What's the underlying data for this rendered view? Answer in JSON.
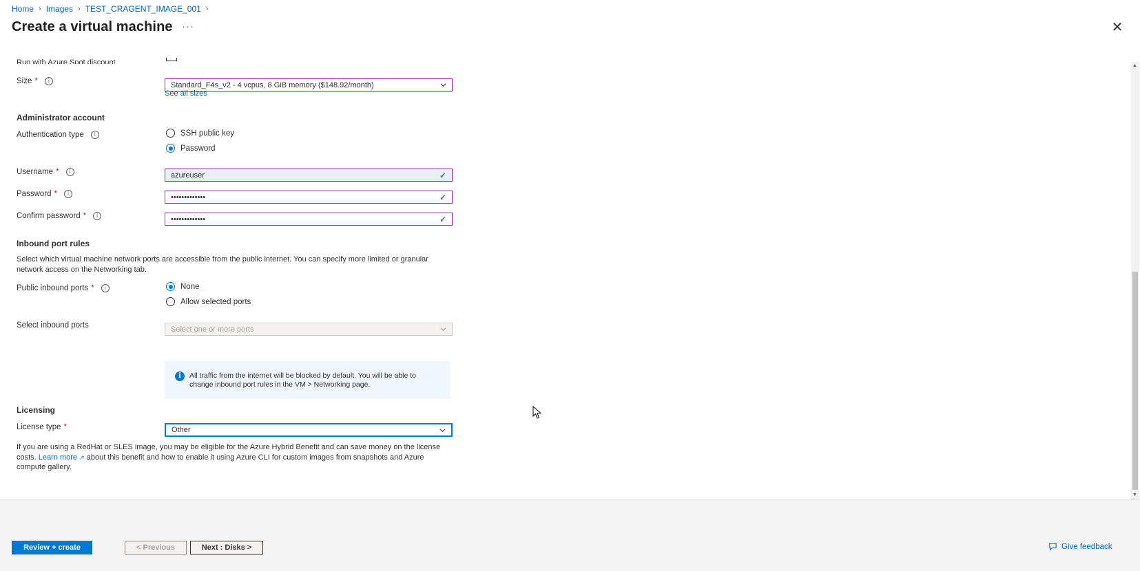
{
  "breadcrumb": {
    "items": [
      "Home",
      "Images",
      "TEST_CRAGENT_IMAGE_001"
    ]
  },
  "page": {
    "title": "Create a virtual machine",
    "more": "···",
    "close": "✕"
  },
  "partial_row": {
    "label": "Run with Azure Spot discount"
  },
  "size": {
    "label": "Size",
    "required": "*",
    "value": "Standard_F4s_v2 - 4 vcpus, 8 GiB memory ($148.92/month)",
    "see_all": "See all sizes"
  },
  "admin": {
    "heading": "Administrator account",
    "auth_label": "Authentication type",
    "auth_options": [
      "SSH public key",
      "Password"
    ],
    "auth_selected": "Password",
    "username_label": "Username",
    "username_value": "azureuser",
    "password_label": "Password",
    "password_value": "•••••••••••••",
    "confirm_label": "Confirm password",
    "confirm_value": "•••••••••••••"
  },
  "inbound": {
    "heading": "Inbound port rules",
    "description": "Select which virtual machine network ports are accessible from the public internet. You can specify more limited or granular network access on the Networking tab.",
    "public_label": "Public inbound ports",
    "public_options": [
      "None",
      "Allow selected ports"
    ],
    "public_selected": "None",
    "select_label": "Select inbound ports",
    "select_placeholder": "Select one or more ports",
    "info_text": "All traffic from the internet will be blocked by default. You will be able to change inbound port rules in the VM > Networking page."
  },
  "licensing": {
    "heading": "Licensing",
    "type_label": "License type",
    "type_value": "Other",
    "note_before": "If you are using a RedHat or SLES image, you may be eligible for the Azure Hybrid Benefit and can save money on the license costs.",
    "learn_more": "Learn more",
    "note_after": "about this benefit and how to enable it using Azure CLI for custom images from snapshots and Azure compute gallery."
  },
  "footer": {
    "review_create": "Review + create",
    "previous": "< Previous",
    "next": "Next : Disks >",
    "feedback": "Give feedback"
  },
  "colors": {
    "accent": "#0078d4",
    "required": "#a4262c",
    "valid": "#2e8b2e",
    "field_border": "#8a2a9c"
  }
}
